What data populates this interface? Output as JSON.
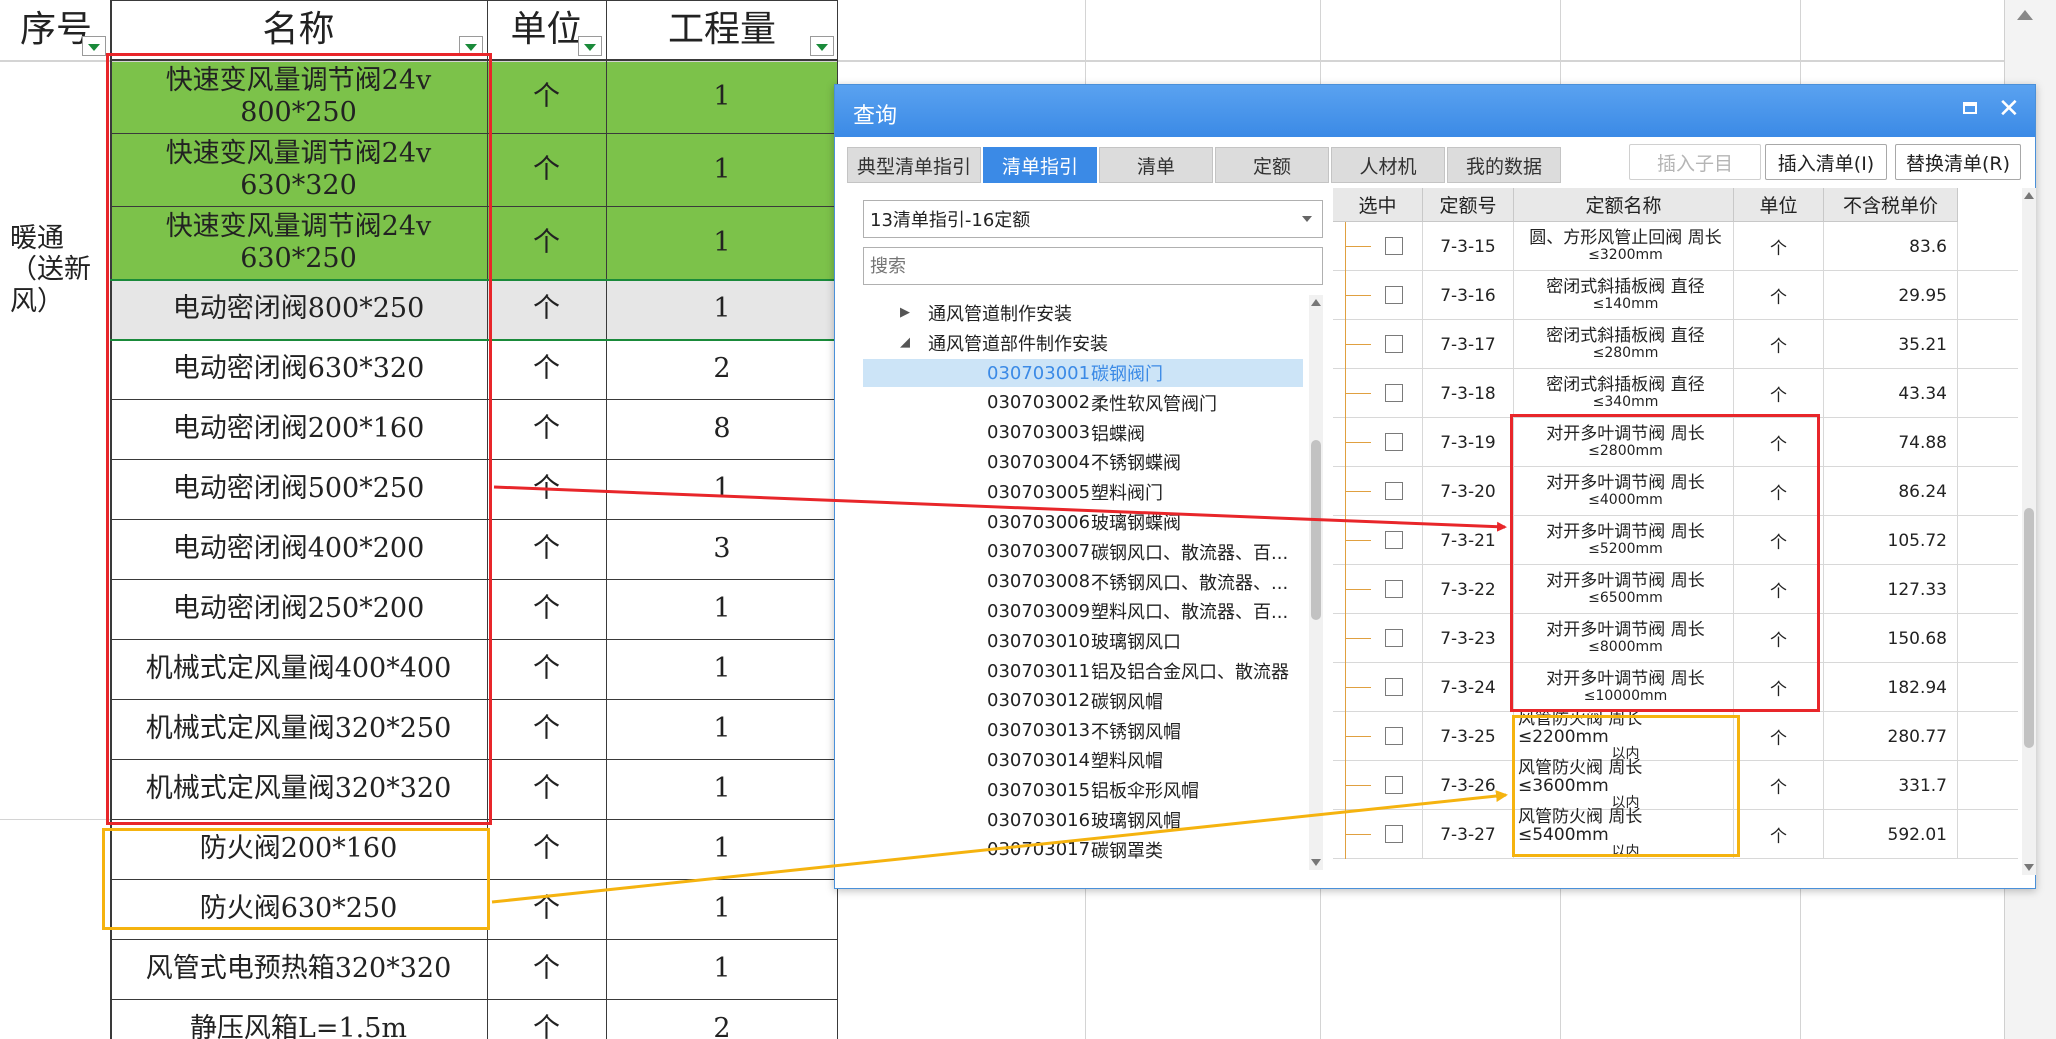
{
  "sheet": {
    "headers": {
      "seq": "序号",
      "name": "名称",
      "unit": "单位",
      "qty": "工程量"
    },
    "group_label": "暖通\n（送新\n风）",
    "rows": [
      {
        "name": "快速变风量调节阀24v\n800*250",
        "unit": "个",
        "qty": "1",
        "fill": "green"
      },
      {
        "name": "快速变风量调节阀24v\n630*320",
        "unit": "个",
        "qty": "1",
        "fill": "green"
      },
      {
        "name": "快速变风量调节阀24v\n630*250",
        "unit": "个",
        "qty": "1",
        "fill": "green"
      },
      {
        "name": "电动密闭阀800*250",
        "unit": "个",
        "qty": "1",
        "fill": "grey"
      },
      {
        "name": "电动密闭阀630*320",
        "unit": "个",
        "qty": "2",
        "fill": ""
      },
      {
        "name": "电动密闭阀200*160",
        "unit": "个",
        "qty": "8",
        "fill": ""
      },
      {
        "name": "电动密闭阀500*250",
        "unit": "个",
        "qty": "1",
        "fill": ""
      },
      {
        "name": "电动密闭阀400*200",
        "unit": "个",
        "qty": "3",
        "fill": ""
      },
      {
        "name": "电动密闭阀250*200",
        "unit": "个",
        "qty": "1",
        "fill": ""
      },
      {
        "name": "机械式定风量阀400*400",
        "unit": "个",
        "qty": "1",
        "fill": ""
      },
      {
        "name": "机械式定风量阀320*250",
        "unit": "个",
        "qty": "1",
        "fill": ""
      },
      {
        "name": "机械式定风量阀320*320",
        "unit": "个",
        "qty": "1",
        "fill": ""
      },
      {
        "name": "防火阀200*160",
        "unit": "个",
        "qty": "1",
        "fill": ""
      },
      {
        "name": "防火阀630*250",
        "unit": "个",
        "qty": "1",
        "fill": ""
      },
      {
        "name": "风管式电预热箱320*320",
        "unit": "个",
        "qty": "1",
        "fill": ""
      },
      {
        "name": "静压风箱L=1.5m",
        "unit": "个",
        "qty": "2",
        "fill": ""
      }
    ]
  },
  "dialog": {
    "title": "查询",
    "tabs": [
      "典型清单指引",
      "清单指引",
      "清单",
      "定额",
      "人材机",
      "我的数据"
    ],
    "active_tab": "清单指引",
    "buttons": {
      "insert_child": "插入子目",
      "insert_list": "插入清单(I)",
      "replace_list": "替换清单(R)"
    },
    "dropdown_value": "13清单指引-16定额",
    "search_placeholder": "搜索",
    "tree": {
      "parents": [
        "通风管道制作安装",
        "通风管道部件制作安装"
      ],
      "items": [
        {
          "code": "030703001",
          "name": "碳钢阀门"
        },
        {
          "code": "030703002",
          "name": "柔性软风管阀门"
        },
        {
          "code": "030703003",
          "name": "铝蝶阀"
        },
        {
          "code": "030703004",
          "name": "不锈钢蝶阀"
        },
        {
          "code": "030703005",
          "name": "塑料阀门"
        },
        {
          "code": "030703006",
          "name": "玻璃钢蝶阀"
        },
        {
          "code": "030703007",
          "name": "碳钢风口、散流器、百..."
        },
        {
          "code": "030703008",
          "name": "不锈钢风口、散流器、..."
        },
        {
          "code": "030703009",
          "name": "塑料风口、散流器、百..."
        },
        {
          "code": "030703010",
          "name": "玻璃钢风口"
        },
        {
          "code": "030703011",
          "name": "铝及铝合金风口、散流器"
        },
        {
          "code": "030703012",
          "name": "碳钢风帽"
        },
        {
          "code": "030703013",
          "name": "不锈钢风帽"
        },
        {
          "code": "030703014",
          "name": "塑料风帽"
        },
        {
          "code": "030703015",
          "name": "铝板伞形风帽"
        },
        {
          "code": "030703016",
          "name": "玻璃钢风帽"
        },
        {
          "code": "030703017",
          "name": "碳钢罩类"
        }
      ],
      "selected": "030703001"
    },
    "grid": {
      "headers": [
        "选中",
        "定额号",
        "定额名称",
        "单位",
        "不含税单价"
      ],
      "rows": [
        {
          "code": "7-3-15",
          "name1": "圆、方形风管止回阀 周长",
          "name2": "≤3200mm",
          "unit": "个",
          "price": "83.6"
        },
        {
          "code": "7-3-16",
          "name1": "密闭式斜插板阀 直径",
          "name2": "≤140mm",
          "unit": "个",
          "price": "29.95"
        },
        {
          "code": "7-3-17",
          "name1": "密闭式斜插板阀 直径",
          "name2": "≤280mm",
          "unit": "个",
          "price": "35.21"
        },
        {
          "code": "7-3-18",
          "name1": "密闭式斜插板阀 直径",
          "name2": "≤340mm",
          "unit": "个",
          "price": "43.34"
        },
        {
          "code": "7-3-19",
          "name1": "对开多叶调节阀 周长",
          "name2": "≤2800mm",
          "unit": "个",
          "price": "74.88"
        },
        {
          "code": "7-3-20",
          "name1": "对开多叶调节阀 周长",
          "name2": "≤4000mm",
          "unit": "个",
          "price": "86.24"
        },
        {
          "code": "7-3-21",
          "name1": "对开多叶调节阀 周长",
          "name2": "≤5200mm",
          "unit": "个",
          "price": "105.72"
        },
        {
          "code": "7-3-22",
          "name1": "对开多叶调节阀 周长",
          "name2": "≤6500mm",
          "unit": "个",
          "price": "127.33"
        },
        {
          "code": "7-3-23",
          "name1": "对开多叶调节阀 周长",
          "name2": "≤8000mm",
          "unit": "个",
          "price": "150.68"
        },
        {
          "code": "7-3-24",
          "name1": "对开多叶调节阀 周长",
          "name2": "≤10000mm",
          "unit": "个",
          "price": "182.94"
        },
        {
          "code": "7-3-25",
          "name1": "风管防火阀 周长≤2200mm",
          "name2": "以内",
          "unit": "个",
          "price": "280.77"
        },
        {
          "code": "7-3-26",
          "name1": "风管防火阀 周长≤3600mm",
          "name2": "以内",
          "unit": "个",
          "price": "331.7"
        },
        {
          "code": "7-3-27",
          "name1": "风管防火阀 周长≤5400mm",
          "name2": "以内",
          "unit": "个",
          "price": "592.01"
        }
      ]
    }
  },
  "colors": {
    "highlight_red": "#e8262a",
    "highlight_orange": "#f5b30f",
    "accent_blue": "#3b8ae6",
    "green_fill": "#7cc24a"
  }
}
